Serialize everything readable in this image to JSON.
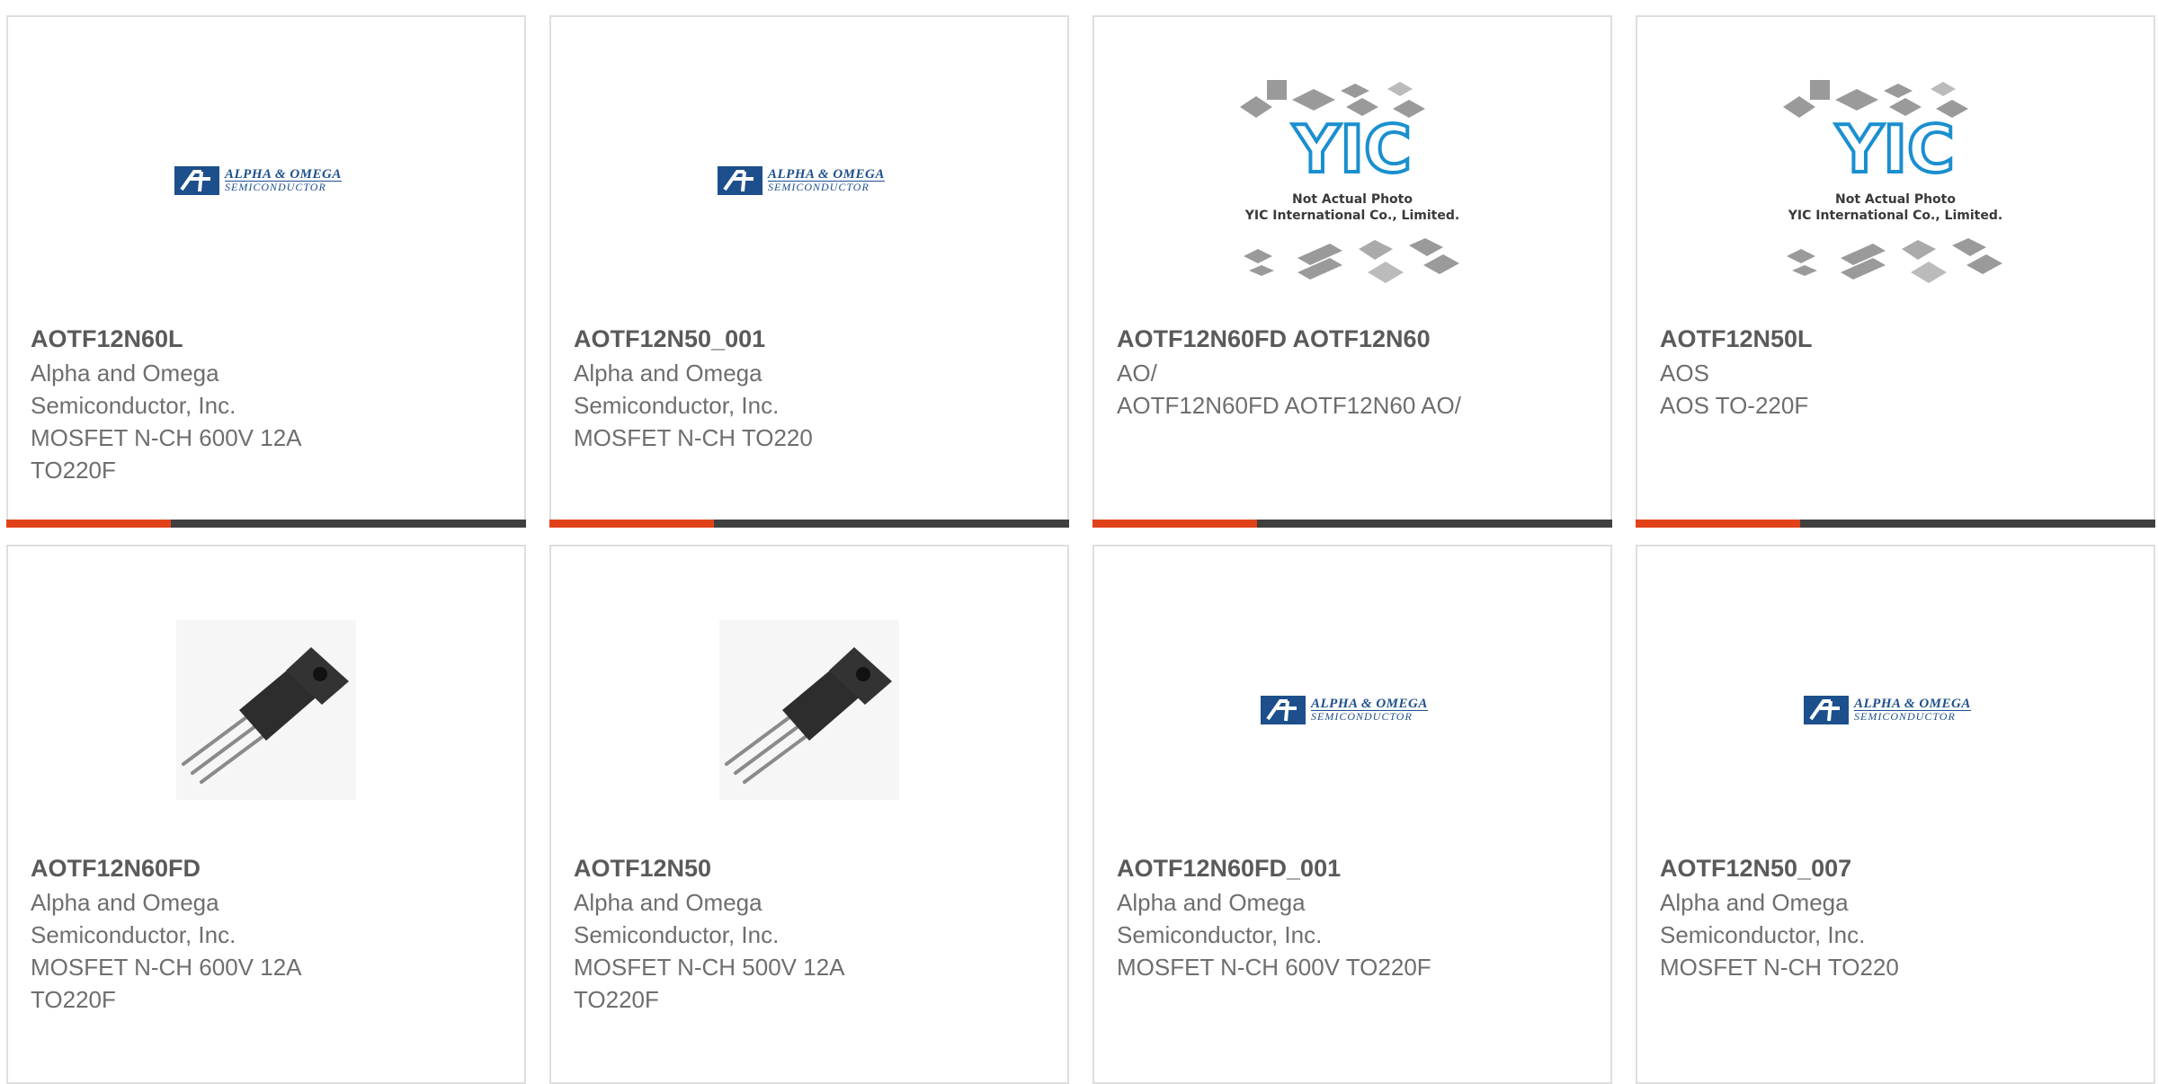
{
  "logo_text": {
    "aos_line1": "ALPHA & OMEGA",
    "aos_line2": "SEMICONDUCTOR",
    "yic_mark": "YIC",
    "yic_caption_1": "Not Actual Photo",
    "yic_caption_2": "YIC International Co., Limited."
  },
  "colors": {
    "accent": "#e2421a",
    "bar": "#3f3f3f",
    "aos_blue": "#1d4f8c",
    "yic_blue": "#1a8fd0"
  },
  "products": [
    {
      "part": "AOTF12N60L",
      "line1": "Alpha and Omega",
      "line2": "Semiconductor, Inc.",
      "line3": "MOSFET N-CH 600V 12A",
      "line4": "TO220F",
      "image": "aos-logo"
    },
    {
      "part": "AOTF12N50_001",
      "line1": "Alpha and Omega",
      "line2": "Semiconductor, Inc.",
      "line3": "MOSFET N-CH TO220",
      "line4": "",
      "image": "aos-logo"
    },
    {
      "part": "AOTF12N60FD AOTF12N60",
      "line1": "AO/",
      "line2": "AOTF12N60FD AOTF12N60 AO/",
      "line3": "",
      "line4": "",
      "image": "yic-placeholder"
    },
    {
      "part": "AOTF12N50L",
      "line1": "AOS",
      "line2": "AOS TO-220F",
      "line3": "",
      "line4": "",
      "image": "yic-placeholder"
    },
    {
      "part": "AOTF12N60FD",
      "line1": "Alpha and Omega",
      "line2": "Semiconductor, Inc.",
      "line3": "MOSFET N-CH 600V 12A",
      "line4": "TO220F",
      "image": "to220-transistor"
    },
    {
      "part": "AOTF12N50",
      "line1": "Alpha and Omega",
      "line2": "Semiconductor, Inc.",
      "line3": "MOSFET N-CH 500V 12A",
      "line4": "TO220F",
      "image": "to220-transistor"
    },
    {
      "part": "AOTF12N60FD_001",
      "line1": "Alpha and Omega",
      "line2": "Semiconductor, Inc.",
      "line3": "MOSFET N-CH 600V TO220F",
      "line4": "",
      "image": "aos-logo"
    },
    {
      "part": "AOTF12N50_007",
      "line1": "Alpha and Omega",
      "line2": "Semiconductor, Inc.",
      "line3": "MOSFET N-CH TO220",
      "line4": "",
      "image": "aos-logo"
    }
  ]
}
